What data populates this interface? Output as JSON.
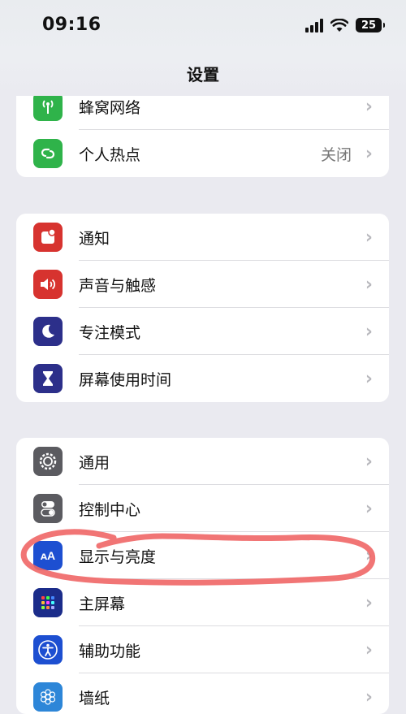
{
  "status_bar": {
    "time": "09:16",
    "battery": "25"
  },
  "nav": {
    "title": "设置"
  },
  "groups": [
    {
      "rows": [
        {
          "label": "蜂窝网络",
          "value": "",
          "icon": "cellular-icon",
          "color": "#2fb34a"
        },
        {
          "label": "个人热点",
          "value": "关闭",
          "icon": "hotspot-icon",
          "color": "#2fb34a"
        }
      ]
    },
    {
      "rows": [
        {
          "label": "通知",
          "icon": "notifications-icon",
          "color": "#d7332f"
        },
        {
          "label": "声音与触感",
          "icon": "sound-icon",
          "color": "#d7332f"
        },
        {
          "label": "专注模式",
          "icon": "moon-icon",
          "color": "#2c2f8a"
        },
        {
          "label": "屏幕使用时间",
          "icon": "hourglass-icon",
          "color": "#2c2f8a"
        }
      ]
    },
    {
      "rows": [
        {
          "label": "通用",
          "icon": "gear-icon",
          "color": "#5b5b60"
        },
        {
          "label": "控制中心",
          "icon": "toggles-icon",
          "color": "#5b5b60"
        },
        {
          "label": "显示与亮度",
          "icon": "display-brightness-icon",
          "color": "#1d4fd1"
        },
        {
          "label": "主屏幕",
          "icon": "home-screen-icon",
          "color": "#1b2c8a"
        },
        {
          "label": "辅助功能",
          "icon": "accessibility-icon",
          "color": "#1d4fd1"
        },
        {
          "label": "墙纸",
          "icon": "wallpaper-icon",
          "color": "#2d86d8"
        }
      ]
    }
  ]
}
